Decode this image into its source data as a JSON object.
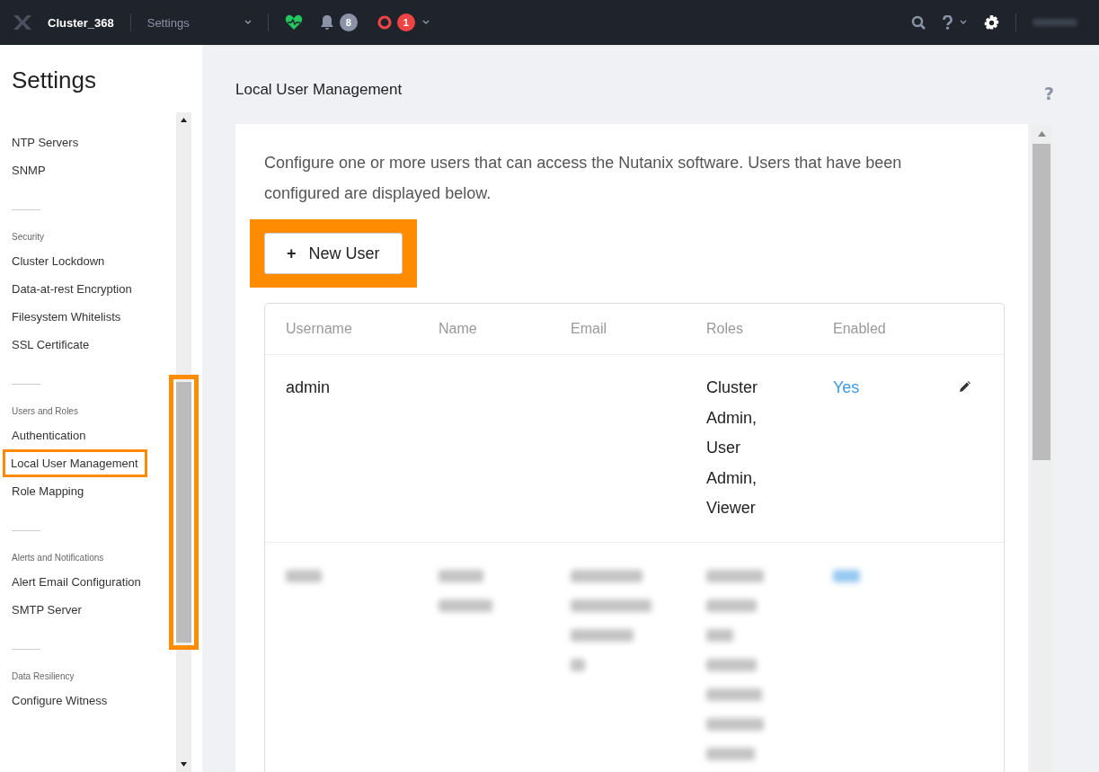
{
  "topbar": {
    "cluster": "Cluster_368",
    "menu": "Settings",
    "alerts_count": "8",
    "critical_count": "1"
  },
  "sidebar": {
    "title": "Settings",
    "sections": [
      {
        "items": [
          {
            "label": "NTP Servers",
            "selected": false
          },
          {
            "label": "SNMP",
            "selected": false
          }
        ]
      },
      {
        "heading": "Security",
        "items": [
          {
            "label": "Cluster Lockdown",
            "selected": false
          },
          {
            "label": "Data-at-rest Encryption",
            "selected": false
          },
          {
            "label": "Filesystem Whitelists",
            "selected": false
          },
          {
            "label": "SSL Certificate",
            "selected": false
          }
        ]
      },
      {
        "heading": "Users and Roles",
        "items": [
          {
            "label": "Authentication",
            "selected": false
          },
          {
            "label": "Local User Management",
            "selected": true
          },
          {
            "label": "Role Mapping",
            "selected": false
          }
        ]
      },
      {
        "heading": "Alerts and Notifications",
        "items": [
          {
            "label": "Alert Email Configuration",
            "selected": false
          },
          {
            "label": "SMTP Server",
            "selected": false
          }
        ]
      },
      {
        "heading": "Data Resiliency",
        "items": [
          {
            "label": "Configure Witness",
            "selected": false
          }
        ]
      }
    ]
  },
  "page": {
    "title": "Local User Management",
    "help": "?",
    "description": "Configure one or more users that can access the Nutanix software. Users that have been configured are displayed below.",
    "new_user_button": {
      "icon": "+",
      "label": "New User",
      "highlighted": true
    },
    "table": {
      "columns": [
        "Username",
        "Name",
        "Email",
        "Roles",
        "Enabled"
      ],
      "rows": [
        {
          "kind": "plain",
          "username": "admin",
          "roles": "Cluster Admin, User Admin, Viewer",
          "enabled": "Yes"
        },
        {
          "kind": "blurred"
        }
      ]
    }
  }
}
